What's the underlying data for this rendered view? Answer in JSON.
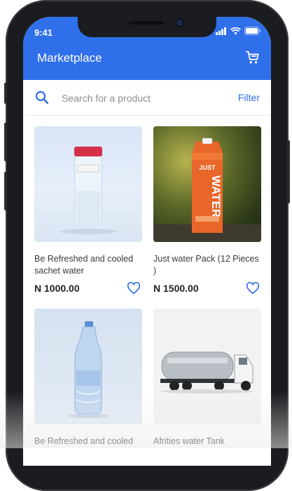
{
  "status": {
    "time": "9:41"
  },
  "header": {
    "title": "Marketplace",
    "cart_icon": "cart-icon"
  },
  "search": {
    "placeholder": "Search for a product",
    "filter_label": "Filter"
  },
  "products": [
    {
      "name": "Be Refreshed and cooled sachet water",
      "price": "N 1000.00",
      "image": "water-bottle-glass-photo"
    },
    {
      "name": "Just water Pack (12 Pieces )",
      "price": "N 1500.00",
      "image": "just-water-carton-photo"
    },
    {
      "name": "Be Refreshed and cooled",
      "price": "",
      "image": "plastic-water-bottle-photo"
    },
    {
      "name": "Afrities water Tank",
      "price": "",
      "image": "water-tanker-truck-photo"
    }
  ],
  "colors": {
    "accent": "#2f6fea",
    "heart": "#2f6fea"
  }
}
